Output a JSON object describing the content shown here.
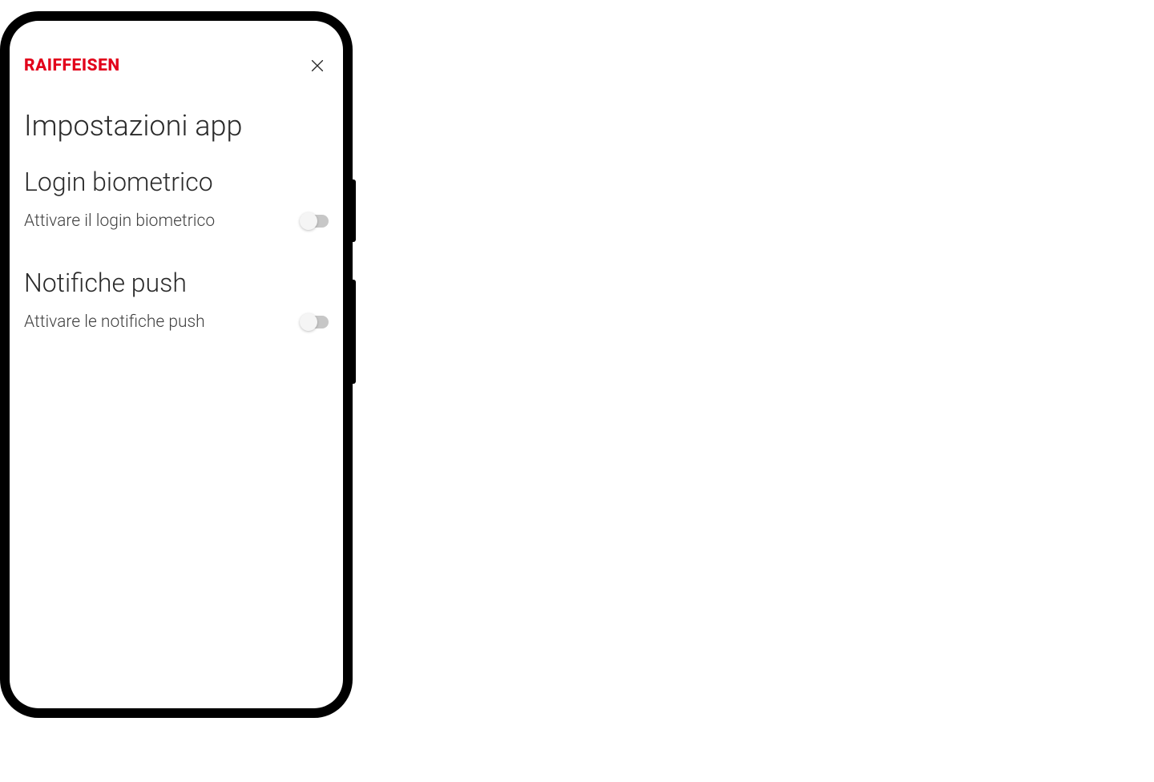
{
  "brand": "RAIFFEISEN",
  "page_title": "Impostazioni app",
  "sections": {
    "biometric": {
      "title": "Login biometrico",
      "setting_label": "Attivare il login biometrico",
      "enabled": false
    },
    "push": {
      "title": "Notifiche push",
      "setting_label": "Attivare le notifiche push",
      "enabled": false
    }
  },
  "colors": {
    "brand_red": "#e2001a"
  }
}
